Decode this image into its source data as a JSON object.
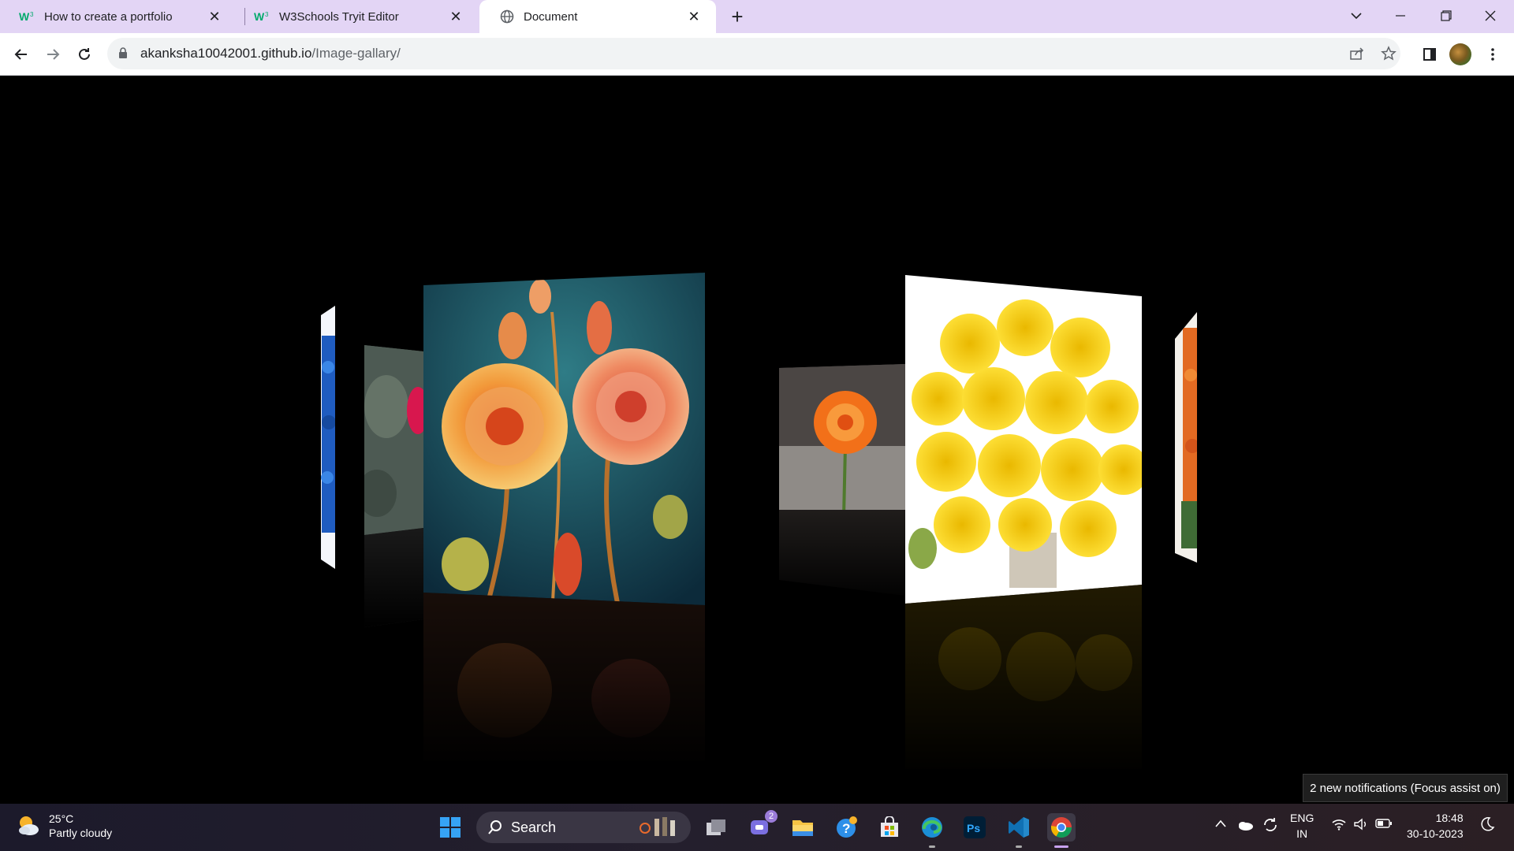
{
  "browser": {
    "tabs": [
      {
        "title": "How to create a portfolio",
        "favicon": "w3schools-icon",
        "active": false
      },
      {
        "title": "W3Schools Tryit Editor",
        "favicon": "w3schools-icon",
        "active": false
      },
      {
        "title": "Document",
        "favicon": "globe-icon",
        "active": true
      }
    ],
    "url_host": "akanksha10042001.github.io",
    "url_path": "/Image-gallary/"
  },
  "gallery": {
    "images": [
      {
        "name": "blue-roses"
      },
      {
        "name": "pink-rose"
      },
      {
        "name": "orange-red-roses-painting"
      },
      {
        "name": "orange-rose"
      },
      {
        "name": "yellow-roses-bouquet"
      },
      {
        "name": "orange-flowers"
      }
    ]
  },
  "notification": {
    "text": "2 new notifications (Focus assist on)"
  },
  "taskbar": {
    "weather": {
      "temp": "25°C",
      "condition": "Partly cloudy"
    },
    "search_label": "Search",
    "chat_badge": "2",
    "language": {
      "line1": "ENG",
      "line2": "IN"
    },
    "clock": {
      "time": "18:48",
      "date": "30-10-2023"
    }
  }
}
